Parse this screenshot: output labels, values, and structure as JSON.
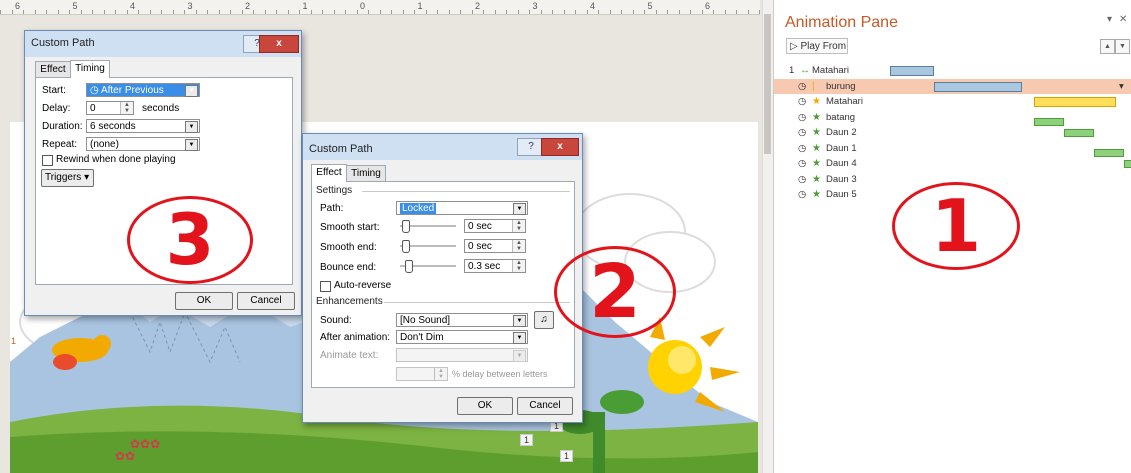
{
  "ruler": {
    "labels": [
      "6",
      "5",
      "4",
      "3",
      "2",
      "1",
      "0",
      "1",
      "2",
      "3",
      "4",
      "5",
      "6"
    ]
  },
  "pane": {
    "title": "Animation Pane",
    "play_from": "Play From",
    "down_glyph": "▾",
    "close_glyph": "✕",
    "up_glyph": "▲",
    "down_order_glyph": "▼",
    "items": [
      {
        "num": "1",
        "icon": "↔",
        "label": "Matahari"
      },
      {
        "num": "",
        "icon": "|",
        "label": "burung"
      },
      {
        "num": "",
        "icon": "★",
        "label": "Matahari"
      },
      {
        "num": "",
        "icon": "★",
        "label": "batang"
      },
      {
        "num": "",
        "icon": "★",
        "label": "Daun 2"
      },
      {
        "num": "",
        "icon": "★",
        "label": "Daun 1"
      },
      {
        "num": "",
        "icon": "★",
        "label": "Daun 4"
      },
      {
        "num": "",
        "icon": "★",
        "label": "Daun 3"
      },
      {
        "num": "",
        "icon": "★",
        "label": "Daun 5"
      }
    ]
  },
  "dlg_timing": {
    "title": "Custom Path",
    "help": "?",
    "close": "x",
    "tab_effect": "Effect",
    "tab_timing": "Timing",
    "start_label": "Start:",
    "start_value": "After Previous",
    "delay_label": "Delay:",
    "delay_value": "0",
    "delay_unit": "seconds",
    "duration_label": "Duration:",
    "duration_value": "6 seconds",
    "repeat_label": "Repeat:",
    "repeat_value": "(none)",
    "rewind_label": "Rewind when done playing",
    "triggers_label": "Triggers ▾",
    "ok": "OK",
    "cancel": "Cancel"
  },
  "dlg_effect": {
    "title": "Custom Path",
    "help": "?",
    "close": "x",
    "tab_effect": "Effect",
    "tab_timing": "Timing",
    "settings_heading": "Settings",
    "path_label": "Path:",
    "path_value": "Locked",
    "smooth_start_label": "Smooth start:",
    "smooth_start_value": "0 sec",
    "smooth_end_label": "Smooth end:",
    "smooth_end_value": "0 sec",
    "bounce_end_label": "Bounce end:",
    "bounce_end_value": "0.3 sec",
    "auto_reverse_label": "Auto-reverse",
    "enhancements_heading": "Enhancements",
    "sound_label": "Sound:",
    "sound_value": "[No Sound]",
    "after_anim_label": "After animation:",
    "after_anim_value": "Don't Dim",
    "animate_text_label": "Animate text:",
    "animate_text_value": "",
    "delay_between_label": "% delay between letters",
    "ok": "OK",
    "cancel": "Cancel"
  },
  "annotations": {
    "one": "1",
    "two": "2",
    "three": "3"
  },
  "slide_tags": {
    "tag1": "1",
    "tag2": "1",
    "tag3": "1",
    "tag_left": "1"
  },
  "colors": {
    "annotation": "#e3131c",
    "pane_title": "#c55a28",
    "selection": "#f7c9b1"
  }
}
